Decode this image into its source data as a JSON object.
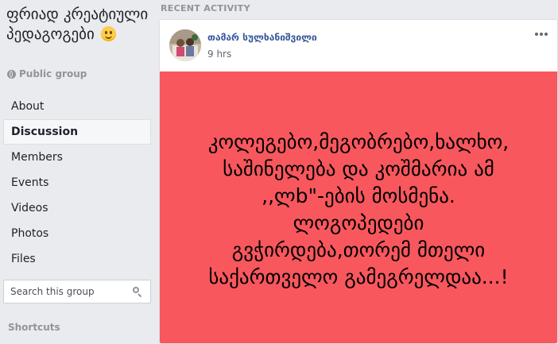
{
  "group": {
    "title": "ფრიად კრეატიული პედაგოგები",
    "privacy": "Public group"
  },
  "nav": {
    "items": [
      {
        "label": "About",
        "active": false
      },
      {
        "label": "Discussion",
        "active": true
      },
      {
        "label": "Members",
        "active": false
      },
      {
        "label": "Events",
        "active": false
      },
      {
        "label": "Videos",
        "active": false
      },
      {
        "label": "Photos",
        "active": false
      },
      {
        "label": "Files",
        "active": false
      }
    ]
  },
  "search": {
    "placeholder": "Search this group"
  },
  "shortcuts": {
    "label": "Shortcuts"
  },
  "feed": {
    "section_label": "RECENT ACTIVITY"
  },
  "post": {
    "author": "თამარ სულხანიშვილი",
    "time": "9 hrs",
    "lines": [
      "კოლეგებო,მეგობრებო,ხალხო,",
      "საშინელება და კოშმარია ამ",
      ",,ლb\"-ების მოსმენა.",
      "ლოგოპედები",
      "გვჭირდება,თორემ მთელი",
      "საქართველო გამეგრელდაა...!"
    ],
    "background_color": "#f7575d"
  },
  "icons": {
    "privacy": "globe-icon",
    "search": "search-icon",
    "more": "more-options-icon",
    "emoji": "smiley-emoji-icon"
  }
}
